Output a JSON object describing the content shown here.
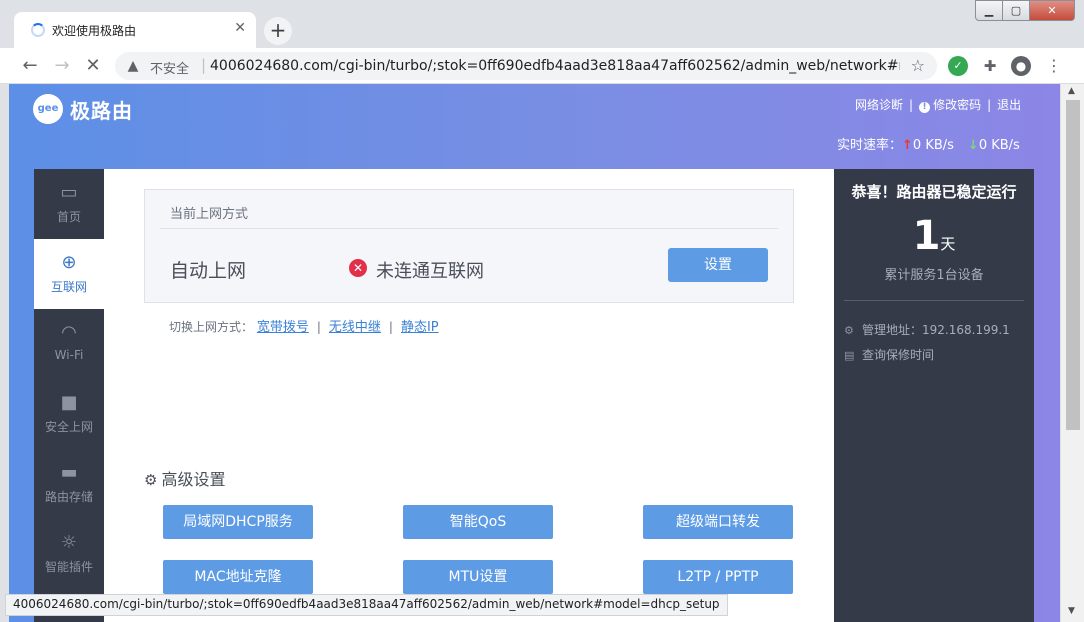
{
  "browser": {
    "tab_title": "欢迎使用极路由",
    "insecure_label": "不安全",
    "url": "4006024680.com/cgi-bin/turbo/;stok=0ff690edfb4aad3e818aa47aff602562/admin_web/network#m...",
    "status_url": "4006024680.com/cgi-bin/turbo/;stok=0ff690edfb4aad3e818aa47aff602562/admin_web/network#model=dhcp_setup"
  },
  "header": {
    "logo_text": "gee",
    "brand": "极路由",
    "links": [
      "网络诊断",
      "修改密码",
      "退出"
    ],
    "speed_label": "实时速率：",
    "upload": "0 KB/s",
    "download": "0 KB/s"
  },
  "sidebar": {
    "items": [
      {
        "label": "首页"
      },
      {
        "label": "互联网"
      },
      {
        "label": "Wi-Fi"
      },
      {
        "label": "安全上网"
      },
      {
        "label": "路由存储"
      },
      {
        "label": "智能插件"
      }
    ]
  },
  "main": {
    "box_title": "当前上网方式",
    "mode": "自动上网",
    "status": "未连通互联网",
    "set_button": "设置",
    "switch_label": "切换上网方式：",
    "switch_options": [
      "宽带拨号",
      "无线中继",
      "静态IP"
    ],
    "advanced_title": "高级设置",
    "advanced_buttons": [
      "局域网DHCP服务",
      "智能QoS",
      "超级端口转发",
      "MAC地址克隆",
      "MTU设置",
      "L2TP / PPTP"
    ]
  },
  "panel": {
    "congrats": "恭喜！路由器已稳定运行",
    "days": "1",
    "days_unit": "天",
    "served": "累计服务1台设备",
    "admin_address": "管理地址：192.168.199.1",
    "warranty": "查询保修时间"
  }
}
